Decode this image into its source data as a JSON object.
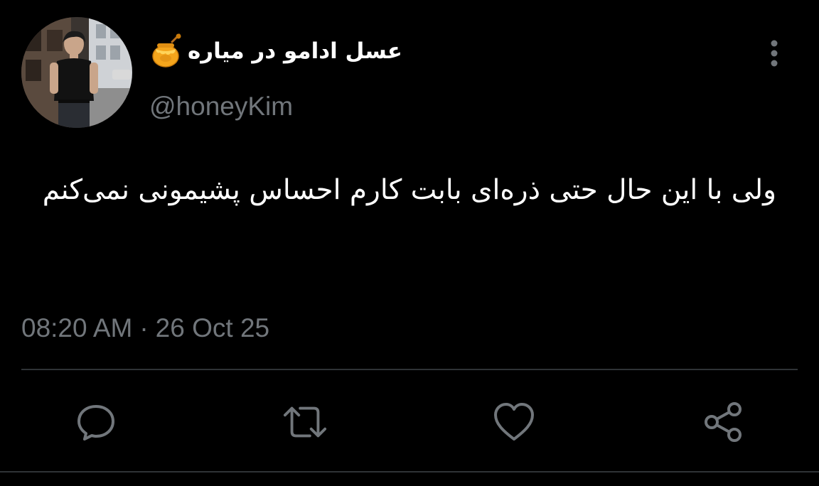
{
  "user": {
    "display_name": "عسل ادامو در میاره",
    "display_name_emoji": "honey-pot-icon",
    "handle": "@honeyKim",
    "avatar": "profile-photo"
  },
  "tweet": {
    "text": "ولی با این حال حتی ذره‌ای بابت کارم احساس پشیمونی نمی‌کنم",
    "time": "08:20 AM",
    "separator": "·",
    "date": "26 Oct 25"
  },
  "actions": {
    "reply_icon": "reply-icon",
    "retweet_icon": "retweet-icon",
    "like_icon": "heart-icon",
    "share_icon": "share-icon",
    "more_icon": "more-vertical-icon"
  },
  "colors": {
    "background": "#000000",
    "primary_text": "#ffffff",
    "secondary_text": "#71767b",
    "divider": "#2f3336",
    "icon": "#71767b",
    "honey": "#f4a51c"
  }
}
